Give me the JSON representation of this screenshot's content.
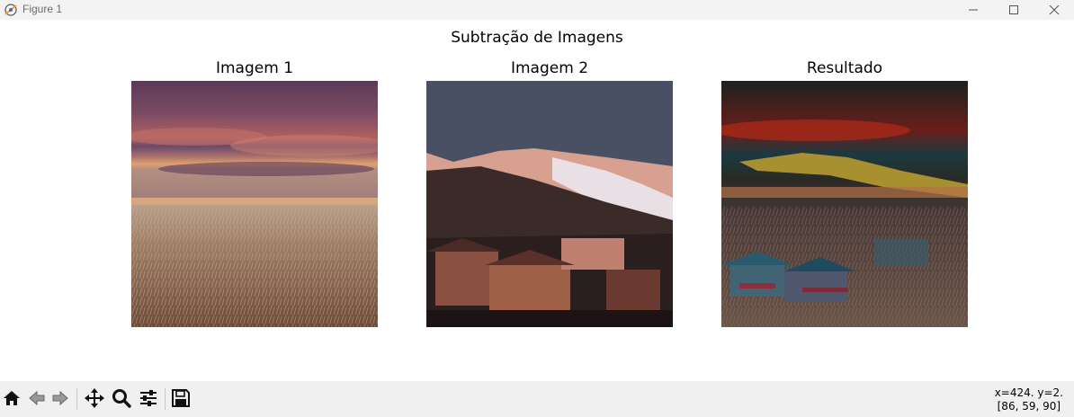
{
  "window": {
    "title": "Figure 1",
    "icon": "matplotlib-figure-icon",
    "controls": [
      "minimize-icon",
      "maximize-icon",
      "close-icon"
    ]
  },
  "figure": {
    "suptitle": "Subtração de Imagens",
    "subplots": [
      {
        "title": "Imagem 1",
        "content": "wheat field at sunset photo"
      },
      {
        "title": "Imagem 2",
        "content": "mountain village at dusk photo"
      },
      {
        "title": "Resultado",
        "content": "subtracted result image"
      }
    ]
  },
  "toolbar": {
    "buttons": [
      "home-icon",
      "back-icon",
      "forward-icon",
      "pan-icon",
      "zoom-icon",
      "configure-subplots-icon",
      "save-icon"
    ],
    "coords_line1": "x=424. y=2.",
    "coords_line2": "[86, 59, 90]"
  }
}
